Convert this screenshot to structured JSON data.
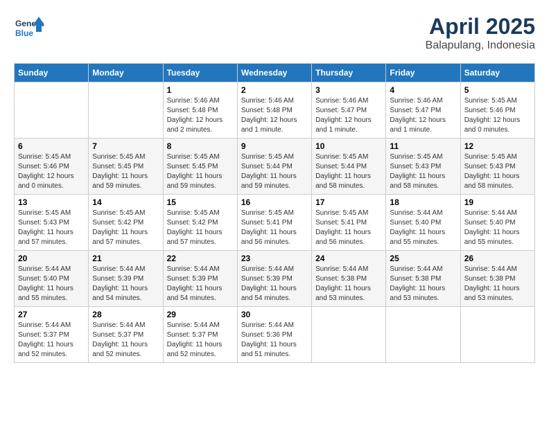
{
  "logo": {
    "line1": "General",
    "line2": "Blue",
    "arrow_color": "#2176bd"
  },
  "title": "April 2025",
  "location": "Balapulang, Indonesia",
  "days_of_week": [
    "Sunday",
    "Monday",
    "Tuesday",
    "Wednesday",
    "Thursday",
    "Friday",
    "Saturday"
  ],
  "weeks": [
    [
      {
        "day": "",
        "info": ""
      },
      {
        "day": "",
        "info": ""
      },
      {
        "day": "1",
        "info": "Sunrise: 5:46 AM\nSunset: 5:48 PM\nDaylight: 12 hours\nand 2 minutes."
      },
      {
        "day": "2",
        "info": "Sunrise: 5:46 AM\nSunset: 5:48 PM\nDaylight: 12 hours\nand 1 minute."
      },
      {
        "day": "3",
        "info": "Sunrise: 5:46 AM\nSunset: 5:47 PM\nDaylight: 12 hours\nand 1 minute."
      },
      {
        "day": "4",
        "info": "Sunrise: 5:46 AM\nSunset: 5:47 PM\nDaylight: 12 hours\nand 1 minute."
      },
      {
        "day": "5",
        "info": "Sunrise: 5:45 AM\nSunset: 5:46 PM\nDaylight: 12 hours\nand 0 minutes."
      }
    ],
    [
      {
        "day": "6",
        "info": "Sunrise: 5:45 AM\nSunset: 5:46 PM\nDaylight: 12 hours\nand 0 minutes."
      },
      {
        "day": "7",
        "info": "Sunrise: 5:45 AM\nSunset: 5:45 PM\nDaylight: 11 hours\nand 59 minutes."
      },
      {
        "day": "8",
        "info": "Sunrise: 5:45 AM\nSunset: 5:45 PM\nDaylight: 11 hours\nand 59 minutes."
      },
      {
        "day": "9",
        "info": "Sunrise: 5:45 AM\nSunset: 5:44 PM\nDaylight: 11 hours\nand 59 minutes."
      },
      {
        "day": "10",
        "info": "Sunrise: 5:45 AM\nSunset: 5:44 PM\nDaylight: 11 hours\nand 58 minutes."
      },
      {
        "day": "11",
        "info": "Sunrise: 5:45 AM\nSunset: 5:43 PM\nDaylight: 11 hours\nand 58 minutes."
      },
      {
        "day": "12",
        "info": "Sunrise: 5:45 AM\nSunset: 5:43 PM\nDaylight: 11 hours\nand 58 minutes."
      }
    ],
    [
      {
        "day": "13",
        "info": "Sunrise: 5:45 AM\nSunset: 5:43 PM\nDaylight: 11 hours\nand 57 minutes."
      },
      {
        "day": "14",
        "info": "Sunrise: 5:45 AM\nSunset: 5:42 PM\nDaylight: 11 hours\nand 57 minutes."
      },
      {
        "day": "15",
        "info": "Sunrise: 5:45 AM\nSunset: 5:42 PM\nDaylight: 11 hours\nand 57 minutes."
      },
      {
        "day": "16",
        "info": "Sunrise: 5:45 AM\nSunset: 5:41 PM\nDaylight: 11 hours\nand 56 minutes."
      },
      {
        "day": "17",
        "info": "Sunrise: 5:45 AM\nSunset: 5:41 PM\nDaylight: 11 hours\nand 56 minutes."
      },
      {
        "day": "18",
        "info": "Sunrise: 5:44 AM\nSunset: 5:40 PM\nDaylight: 11 hours\nand 55 minutes."
      },
      {
        "day": "19",
        "info": "Sunrise: 5:44 AM\nSunset: 5:40 PM\nDaylight: 11 hours\nand 55 minutes."
      }
    ],
    [
      {
        "day": "20",
        "info": "Sunrise: 5:44 AM\nSunset: 5:40 PM\nDaylight: 11 hours\nand 55 minutes."
      },
      {
        "day": "21",
        "info": "Sunrise: 5:44 AM\nSunset: 5:39 PM\nDaylight: 11 hours\nand 54 minutes."
      },
      {
        "day": "22",
        "info": "Sunrise: 5:44 AM\nSunset: 5:39 PM\nDaylight: 11 hours\nand 54 minutes."
      },
      {
        "day": "23",
        "info": "Sunrise: 5:44 AM\nSunset: 5:39 PM\nDaylight: 11 hours\nand 54 minutes."
      },
      {
        "day": "24",
        "info": "Sunrise: 5:44 AM\nSunset: 5:38 PM\nDaylight: 11 hours\nand 53 minutes."
      },
      {
        "day": "25",
        "info": "Sunrise: 5:44 AM\nSunset: 5:38 PM\nDaylight: 11 hours\nand 53 minutes."
      },
      {
        "day": "26",
        "info": "Sunrise: 5:44 AM\nSunset: 5:38 PM\nDaylight: 11 hours\nand 53 minutes."
      }
    ],
    [
      {
        "day": "27",
        "info": "Sunrise: 5:44 AM\nSunset: 5:37 PM\nDaylight: 11 hours\nand 52 minutes."
      },
      {
        "day": "28",
        "info": "Sunrise: 5:44 AM\nSunset: 5:37 PM\nDaylight: 11 hours\nand 52 minutes."
      },
      {
        "day": "29",
        "info": "Sunrise: 5:44 AM\nSunset: 5:37 PM\nDaylight: 11 hours\nand 52 minutes."
      },
      {
        "day": "30",
        "info": "Sunrise: 5:44 AM\nSunset: 5:36 PM\nDaylight: 11 hours\nand 51 minutes."
      },
      {
        "day": "",
        "info": ""
      },
      {
        "day": "",
        "info": ""
      },
      {
        "day": "",
        "info": ""
      }
    ]
  ]
}
